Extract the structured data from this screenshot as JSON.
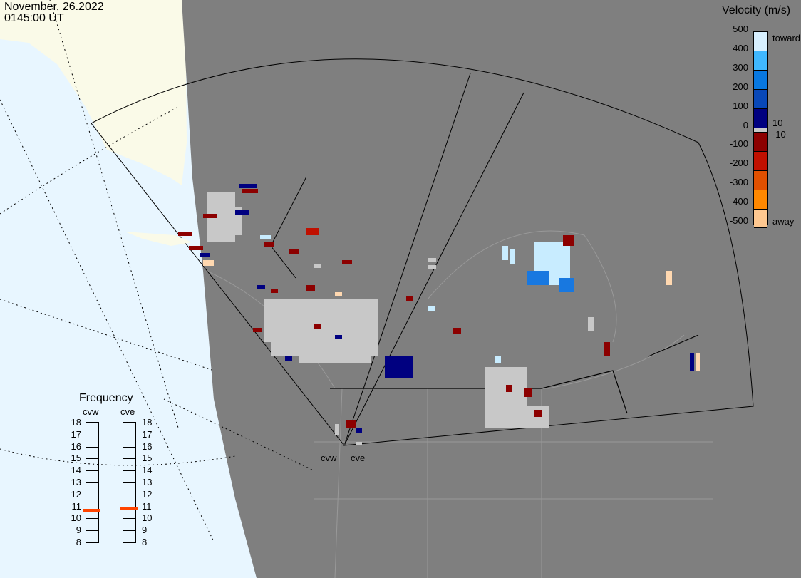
{
  "header": {
    "date": "November, 26.2022",
    "time": "0145:00 UT"
  },
  "colorbar": {
    "title": "Velocity (m/s)",
    "ticks": [
      "500",
      "400",
      "300",
      "200",
      "100",
      "0",
      "-100",
      "-200",
      "-300",
      "-400",
      "-500"
    ],
    "toward_label": "toward",
    "away_label": "away",
    "threshold_pos": "10",
    "threshold_neg": "-10",
    "colors": [
      "#d8f0ff",
      "#40b8ff",
      "#0878e0",
      "#0848b8",
      "#000080",
      "#c8c8c8",
      "#8c0000",
      "#c01000",
      "#e05000",
      "#ff8800",
      "#ffc890"
    ]
  },
  "frequency": {
    "title": "Frequency",
    "unit_range": [
      8,
      18
    ],
    "ticks": [
      "18",
      "17",
      "16",
      "15",
      "14",
      "13",
      "12",
      "11",
      "10",
      "9",
      "8"
    ],
    "radars": [
      {
        "name": "cvw",
        "value_mhz": 10.6
      },
      {
        "name": "cve",
        "value_mhz": 10.8
      }
    ],
    "marker_color": "#ff4400"
  },
  "map": {
    "radar_labels": [
      "cvw",
      "cve"
    ],
    "colors": {
      "ocean": "#e8f6ff",
      "land_day": "#fafae8",
      "night": "#7f7f7f",
      "ground_scatter": "#c8c8c8"
    }
  }
}
